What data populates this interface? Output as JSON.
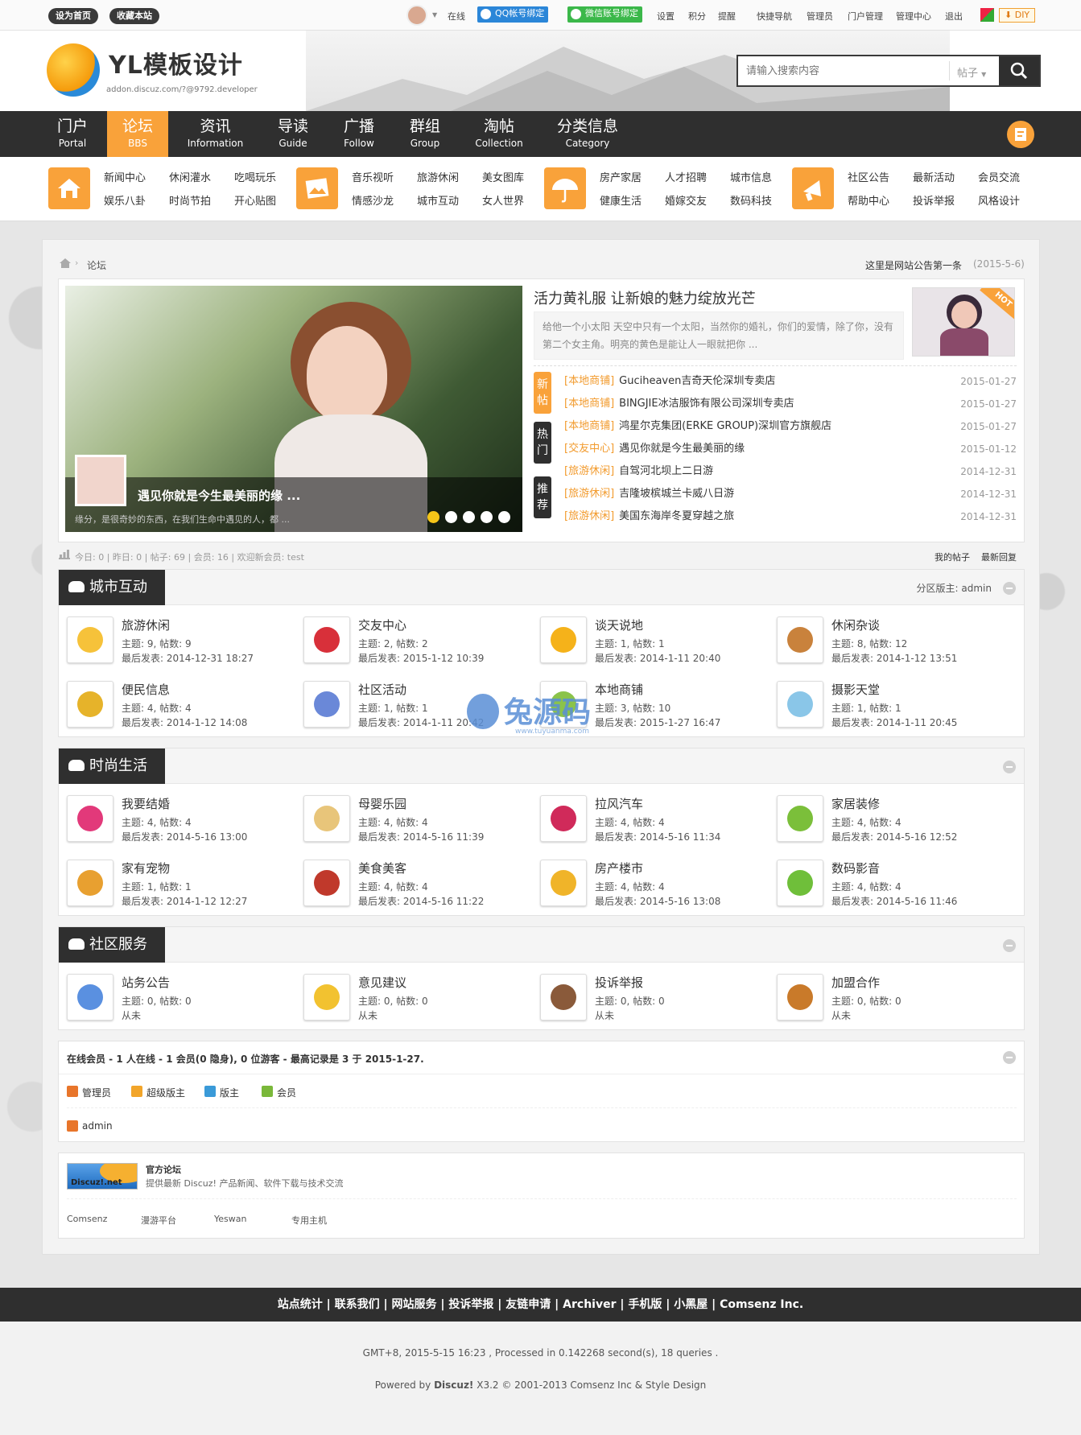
{
  "topbar": {
    "set_home": "设为首页",
    "bookmark": "收藏本站",
    "online": "在线",
    "qq_bind": "QQ帐号绑定",
    "wechat_bind": "微信账号绑定",
    "links": [
      "设置",
      "积分",
      "提醒",
      "快捷导航",
      "管理员",
      "门户管理",
      "管理中心",
      "退出"
    ],
    "diy": "DIY"
  },
  "header": {
    "logo_text": "YL模板设计",
    "logo_sub": "addon.discuz.com/?@9792.developer",
    "search_placeholder": "请输入搜索内容",
    "search_type": "帖子"
  },
  "nav": [
    {
      "cn": "门户",
      "en": "Portal"
    },
    {
      "cn": "论坛",
      "en": "BBS"
    },
    {
      "cn": "资讯",
      "en": "Information"
    },
    {
      "cn": "导读",
      "en": "Guide"
    },
    {
      "cn": "广播",
      "en": "Follow"
    },
    {
      "cn": "群组",
      "en": "Group"
    },
    {
      "cn": "淘帖",
      "en": "Collection"
    },
    {
      "cn": "分类信息",
      "en": "Category"
    }
  ],
  "subnav": [
    [
      "新闻中心",
      "休闲灌水",
      "吃喝玩乐",
      "娱乐八卦",
      "时尚节拍",
      "开心贴图"
    ],
    [
      "音乐视听",
      "旅游休闲",
      "美女图库",
      "情感沙龙",
      "城市互动",
      "女人世界"
    ],
    [
      "房产家居",
      "人才招聘",
      "城市信息",
      "健康生活",
      "婚嫁交友",
      "数码科技"
    ],
    [
      "社区公告",
      "最新活动",
      "会员交流",
      "帮助中心",
      "投诉举报",
      "风格设计"
    ]
  ],
  "breadcrumb": {
    "current": "论坛",
    "notice": "这里是网站公告第一条",
    "notice_date": "(2015-5-6)"
  },
  "slide": {
    "title": "遇见你就是今生最美丽的缘 ...",
    "desc": "缘分，是很奇妙的东西，在我们生命中遇见的人，都 ..."
  },
  "headline": {
    "title": "活力黄礼服 让新娘的魅力绽放光芒",
    "desc": "给他一个小太阳 天空中只有一个太阳，当然你的婚礼，你们的爱情，除了你，没有第二个女主角。明亮的黄色是能让人一眼就把你 ...",
    "badge": "HOT"
  },
  "tabs": [
    [
      "新",
      "帖"
    ],
    [
      "热",
      "门"
    ],
    [
      "推",
      "荐"
    ]
  ],
  "news": [
    {
      "cat": "[本地商铺]",
      "title": "Guciheaven吉奇天伦深圳专卖店",
      "date": "2015-01-27"
    },
    {
      "cat": "[本地商铺]",
      "title": "BINGJIE冰洁服饰有限公司深圳专卖店",
      "date": "2015-01-27"
    },
    {
      "cat": "[本地商铺]",
      "title": "鸿星尔克集团(ERKE GROUP)深圳官方旗舰店",
      "date": "2015-01-27"
    },
    {
      "cat": "[交友中心]",
      "title": "遇见你就是今生最美丽的缘",
      "date": "2015-01-12"
    },
    {
      "cat": "[旅游休闲]",
      "title": "自驾河北坝上二日游",
      "date": "2014-12-31"
    },
    {
      "cat": "[旅游休闲]",
      "title": "吉隆坡槟城兰卡威八日游",
      "date": "2014-12-31"
    },
    {
      "cat": "[旅游休闲]",
      "title": "美国东海岸冬夏穿越之旅",
      "date": "2014-12-31"
    }
  ],
  "stats": {
    "text": "今日: 0 | 昨日: 0 | 帖子: 69 | 会员: 16 | 欢迎新会员: test",
    "my_posts": "我的帖子",
    "latest": "最新回复"
  },
  "sections": [
    {
      "title": "城市互动",
      "moderator": "分区版主: admin",
      "forums": [
        {
          "name": "旅游休闲",
          "stat": "主题: 9, 帖数: 9",
          "last": "最后发表: 2014-12-31 18:27",
          "color": "#f6c23a"
        },
        {
          "name": "交友中心",
          "stat": "主题: 2, 帖数: 2",
          "last": "最后发表: 2015-1-12 10:39",
          "color": "#d8303a"
        },
        {
          "name": "谈天说地",
          "stat": "主题: 1, 帖数: 1",
          "last": "最后发表: 2014-1-11 20:40",
          "color": "#f5b21a"
        },
        {
          "name": "休闲杂谈",
          "stat": "主题: 8, 帖数: 12",
          "last": "最后发表: 2014-1-12 13:51",
          "color": "#c9823c"
        },
        {
          "name": "便民信息",
          "stat": "主题: 4, 帖数: 4",
          "last": "最后发表: 2014-1-12 14:08",
          "color": "#e6b32a"
        },
        {
          "name": "社区活动",
          "stat": "主题: 1, 帖数: 1",
          "last": "最后发表: 2014-1-11 20:42",
          "color": "#6a88d8"
        },
        {
          "name": "本地商铺",
          "stat": "主题: 3, 帖数: 10",
          "last": "最后发表: 2015-1-27 16:47",
          "color": "#8bc34a"
        },
        {
          "name": "摄影天堂",
          "stat": "主题: 1, 帖数: 1",
          "last": "最后发表: 2014-1-11 20:45",
          "color": "#8ac6e8"
        }
      ]
    },
    {
      "title": "时尚生活",
      "moderator": "",
      "forums": [
        {
          "name": "我要结婚",
          "stat": "主题: 4, 帖数: 4",
          "last": "最后发表: 2014-5-16 13:00",
          "color": "#e2397a"
        },
        {
          "name": "母婴乐园",
          "stat": "主题: 4, 帖数: 4",
          "last": "最后发表: 2014-5-16 11:39",
          "color": "#e8c57a"
        },
        {
          "name": "拉风汽车",
          "stat": "主题: 4, 帖数: 4",
          "last": "最后发表: 2014-5-16 11:34",
          "color": "#d02a5a"
        },
        {
          "name": "家居装修",
          "stat": "主题: 4, 帖数: 4",
          "last": "最后发表: 2014-5-16 12:52",
          "color": "#7bbf3a"
        },
        {
          "name": "家有宠物",
          "stat": "主题: 1, 帖数: 1",
          "last": "最后发表: 2014-1-12 12:27",
          "color": "#e8a030"
        },
        {
          "name": "美食美客",
          "stat": "主题: 4, 帖数: 4",
          "last": "最后发表: 2014-5-16 11:22",
          "color": "#c0392b"
        },
        {
          "name": "房产楼市",
          "stat": "主题: 4, 帖数: 4",
          "last": "最后发表: 2014-5-16 13:08",
          "color": "#f0b429"
        },
        {
          "name": "数码影音",
          "stat": "主题: 4, 帖数: 4",
          "last": "最后发表: 2014-5-16 11:46",
          "color": "#6fbf3a"
        }
      ]
    },
    {
      "title": "社区服务",
      "moderator": "",
      "forums": [
        {
          "name": "站务公告",
          "stat": "主题: 0, 帖数: 0",
          "last": "从未",
          "color": "#5a90e0"
        },
        {
          "name": "意见建议",
          "stat": "主题: 0, 帖数: 0",
          "last": "从未",
          "color": "#f2c230"
        },
        {
          "name": "投诉举报",
          "stat": "主题: 0, 帖数: 0",
          "last": "从未",
          "color": "#8a5a3a"
        },
        {
          "name": "加盟合作",
          "stat": "主题: 0, 帖数: 0",
          "last": "从未",
          "color": "#c97a2a"
        }
      ]
    }
  ],
  "online": {
    "title": "在线会员 - 1 人在线 - 1 会员(0 隐身), 0 位游客 - 最高记录是 3 于 2015-1-27.",
    "legend": [
      "管理员",
      "超级版主",
      "版主",
      "会员"
    ],
    "user": "admin"
  },
  "links": {
    "logo_label": "Discuz!.net",
    "title": "官方论坛",
    "desc": "提供最新 Discuz! 产品新闻、软件下载与技术交流",
    "items": [
      "Comsenz",
      "漫游平台",
      "Yeswan",
      "专用主机"
    ]
  },
  "footer": {
    "links": [
      "站点统计",
      "联系我们",
      "网站服务",
      "投诉举报",
      "友链申请",
      "Archiver",
      "手机版",
      "小黑屋",
      "Comsenz Inc."
    ],
    "gmt": "GMT+8, 2015-5-15 16:23 , Processed in 0.142268 second(s), 18 queries .",
    "powered_pre": "Powered by ",
    "powered_brand": "Discuz!",
    "powered_post": " X3.2 © 2001-2013 Comsenz Inc & Style Design"
  },
  "watermark": {
    "text": "兔源码",
    "sub": "www.tuyuanma.com"
  }
}
